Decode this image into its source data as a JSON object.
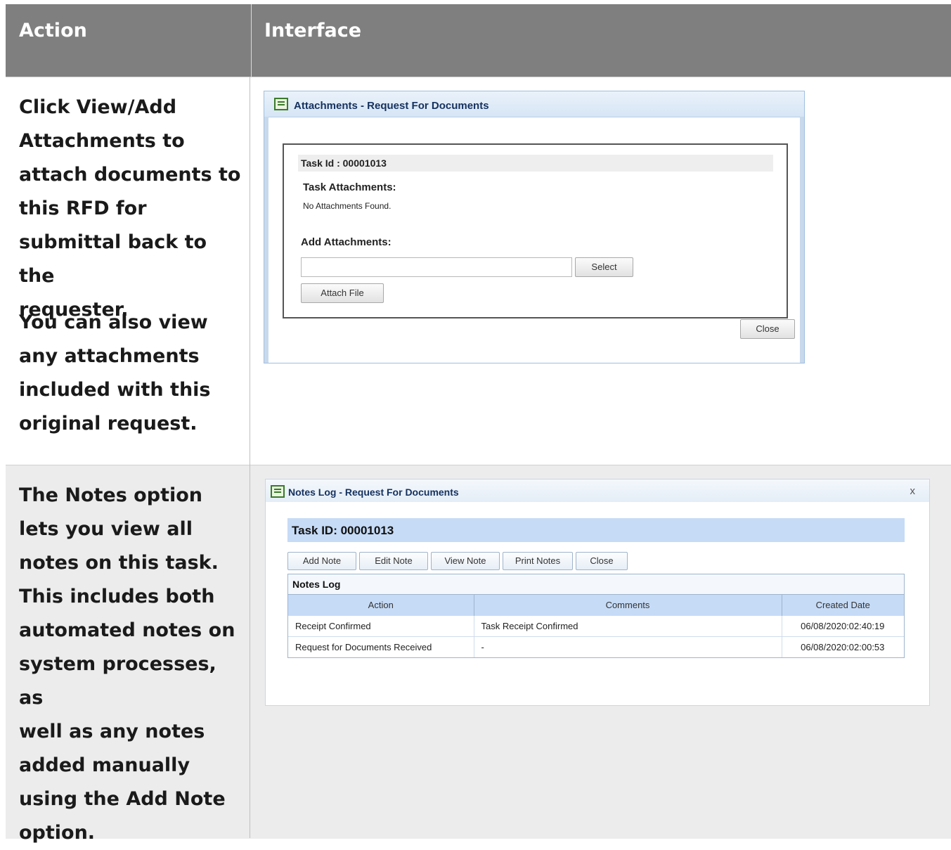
{
  "header": {
    "action": "Action",
    "interface": "Interface"
  },
  "row1": {
    "action_lines": [
      "Click View/Add",
      "Attachments to",
      "attach documents to",
      "this RFD for",
      "submittal back to the",
      "requester."
    ],
    "action_lines2": [
      "You can also view",
      "any attachments",
      "included with this",
      "original request."
    ],
    "dialog": {
      "title": "Attachments - Request For Documents",
      "task_id": "Task Id : 00001013",
      "task_attachments_label": "Task Attachments:",
      "no_attachments": "No Attachments Found.",
      "add_attachments_label": "Add Attachments:",
      "file_input_value": "",
      "select_button": "Select",
      "attach_button": "Attach File",
      "close_button": "Close"
    }
  },
  "row2": {
    "action_lines": [
      "The Notes option",
      "lets you view all",
      "notes on this task.",
      "This includes both",
      "automated notes on",
      "system processes, as",
      "well as any notes",
      "added manually",
      "using the Add Note",
      "option."
    ],
    "dialog": {
      "title": "Notes Log - Request For Documents",
      "close_x": "x",
      "task_id": "Task ID: 00001013",
      "buttons": [
        "Add Note",
        "Edit Note",
        "View Note",
        "Print Notes",
        "Close"
      ],
      "table_caption": "Notes Log",
      "columns": [
        "Action",
        "Comments",
        "Created Date"
      ],
      "rows": [
        [
          "Receipt Confirmed",
          "Task Receipt Confirmed",
          "06/08/2020:02:40:19"
        ],
        [
          "Request for Documents Received",
          "-",
          "06/08/2020:02:00:53"
        ]
      ]
    }
  }
}
